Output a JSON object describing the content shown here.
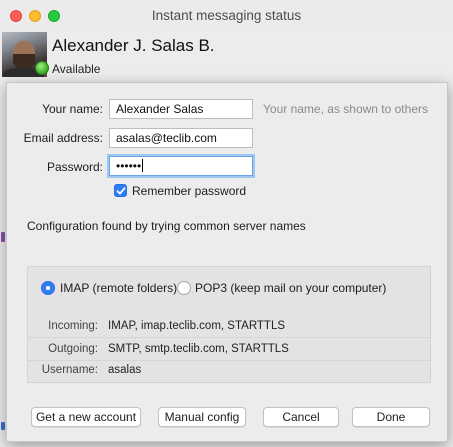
{
  "window": {
    "title": "Instant messaging status"
  },
  "identity": {
    "name": "Alexander J. Salas B.",
    "status": "Available"
  },
  "form": {
    "your_name": {
      "label": "Your name:",
      "value": "Alexander Salas",
      "hint": "Your name, as shown to others"
    },
    "email": {
      "label": "Email address:",
      "value": "asalas@teclib.com"
    },
    "password": {
      "label": "Password:",
      "value": "••••••"
    },
    "remember": {
      "label": "Remember password",
      "checked": true
    }
  },
  "config_message": "Configuration found by trying common server names",
  "server": {
    "imap_label": "IMAP (remote folders)",
    "pop3_label": "POP3 (keep mail on your computer)",
    "selected": "IMAP",
    "rows": [
      {
        "label": "Incoming:",
        "value": "IMAP, imap.teclib.com, STARTTLS"
      },
      {
        "label": "Outgoing:",
        "value": "SMTP, smtp.teclib.com, STARTTLS"
      },
      {
        "label": "Username:",
        "value": "asalas"
      }
    ]
  },
  "buttons": {
    "new_account": "Get a new account",
    "manual_config": "Manual config",
    "cancel": "Cancel",
    "done": "Done"
  },
  "colors": {
    "accent": "#2f7cf6",
    "status_available": "#3cb02a"
  }
}
